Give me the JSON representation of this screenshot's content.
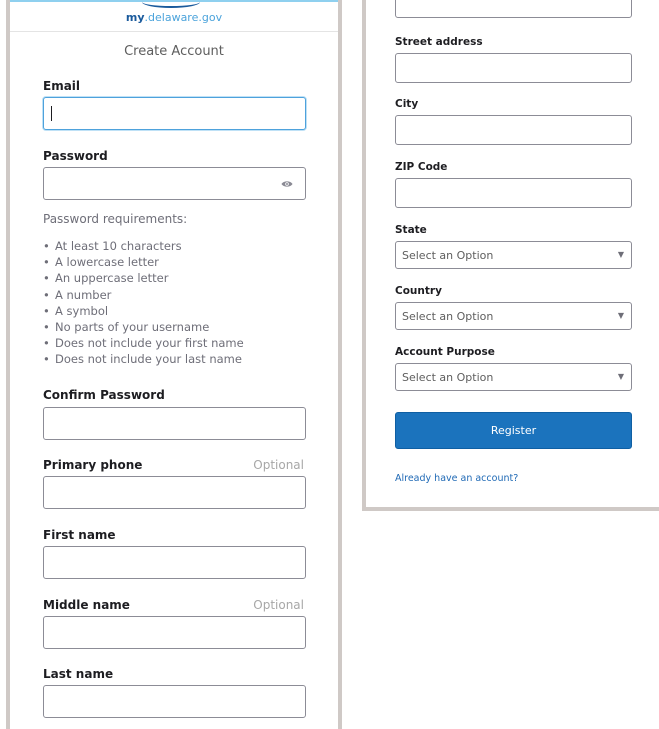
{
  "brand": {
    "part1": "my",
    "part2": ".delaware.gov"
  },
  "form_title": "Create Account",
  "left": {
    "email_label": "Email",
    "password_label": "Password",
    "requirements_title": "Password requirements:",
    "requirements": [
      "At least 10 characters",
      "A lowercase letter",
      "An uppercase letter",
      "A number",
      "A symbol",
      "No parts of your username",
      "Does not include your first name",
      "Does not include your last name"
    ],
    "confirm_label": "Confirm Password",
    "phone_label": "Primary phone",
    "phone_optional": "Optional",
    "first_label": "First name",
    "middle_label": "Middle name",
    "middle_optional": "Optional",
    "last_label": "Last name"
  },
  "right": {
    "street_label": "Street address",
    "city_label": "City",
    "zip_label": "ZIP Code",
    "state_label": "State",
    "state_value": "Select an Option",
    "country_label": "Country",
    "country_value": "Select an Option",
    "purpose_label": "Account Purpose",
    "purpose_value": "Select an Option",
    "register_label": "Register",
    "signin_link": "Already have an account?"
  },
  "colors": {
    "accent": "#1b73bd",
    "focus": "#4ea2dc",
    "link": "#1f69b5",
    "panel_border": "#cfc9c6"
  },
  "icons": {
    "password_toggle": "eye-icon",
    "select_arrow": "chevron-down-icon"
  }
}
